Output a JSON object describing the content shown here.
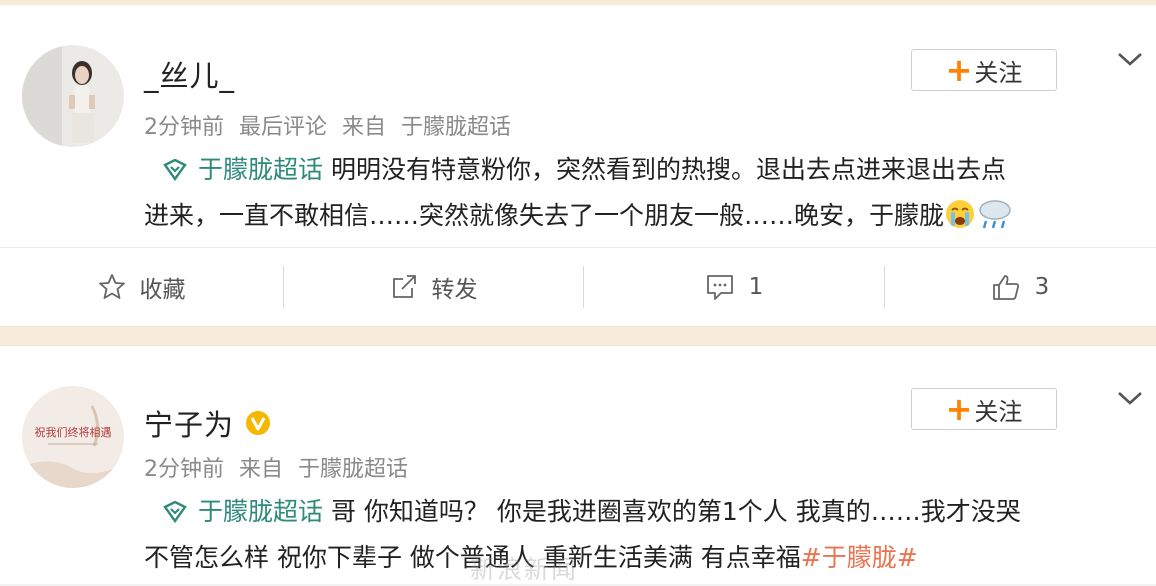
{
  "posts": [
    {
      "username": "_丝儿_",
      "time": "2分钟前",
      "last_comment": "最后评论",
      "from_label": "来自",
      "source": "于朦胧超话",
      "follow_label": "关注",
      "topic": "于朦胧超话",
      "line1": "明明没有特意粉你，突然看到的热搜。退出去点进来退出去点",
      "line2": "进来，一直不敢相信……突然就像失去了一个朋友一般……晚安，于朦胧"
    },
    {
      "username": "宁子为",
      "time": "2分钟前",
      "from_label": "来自",
      "source": "于朦胧超话",
      "follow_label": "关注",
      "topic": "于朦胧超话",
      "line1": "哥 你知道吗？ 你是我进圈喜欢的第1个人 我真的……我才没哭",
      "line2_prefix": "不管怎么样 祝你下辈子 做个普通人 重新生活美满 有点幸福",
      "hashtag": "#于朦胧#",
      "avatar_text": "祝我们终将相遇"
    }
  ],
  "actions": {
    "favorite": "收藏",
    "repost": "转发",
    "comments": "1",
    "likes": "3"
  },
  "watermark": "新浪新闻",
  "colors": {
    "accent": "#ff8200",
    "topic": "#eb7350",
    "hashtag": "#eb7350",
    "verified": "#f5b800"
  }
}
